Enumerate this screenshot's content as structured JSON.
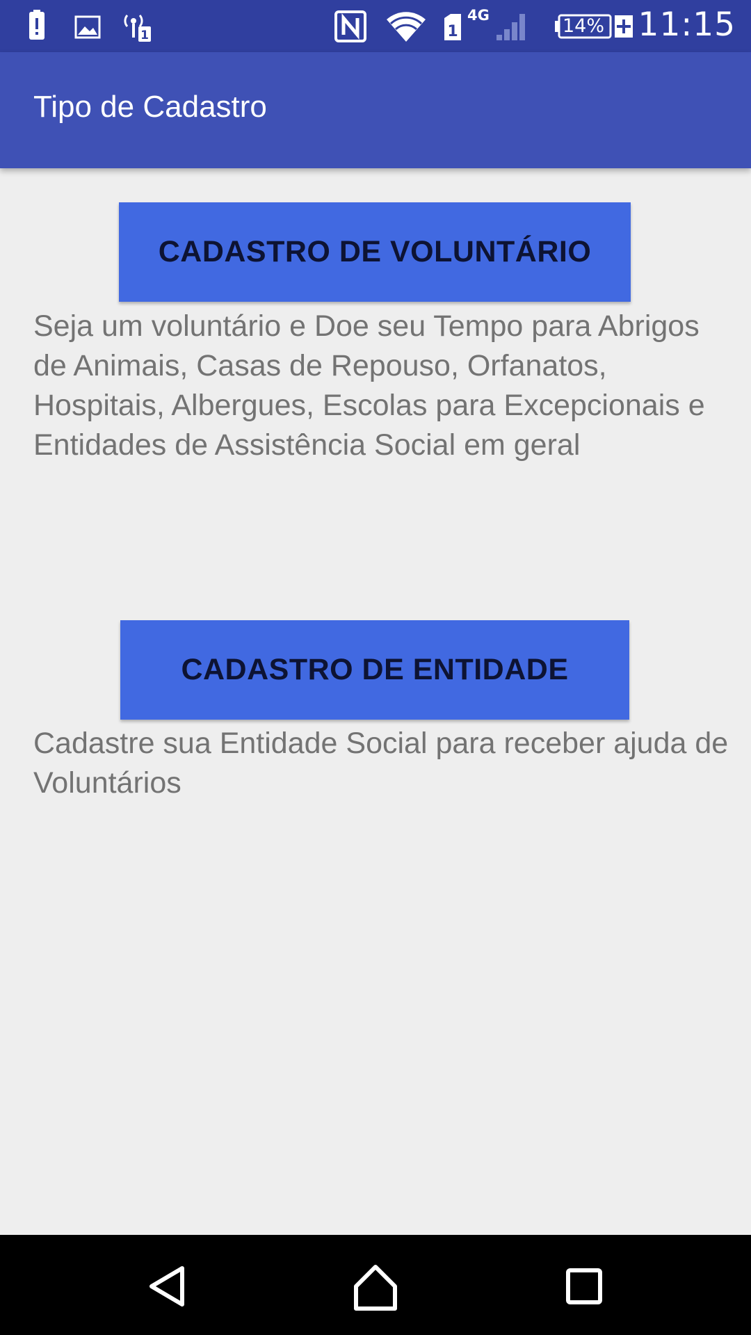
{
  "status_bar": {
    "time": "11:15",
    "battery_percent": "14%",
    "network_type": "4G",
    "sim_slot": "1",
    "icons": [
      "alert-icon",
      "image-icon",
      "hotspot-icon",
      "nfc-icon",
      "wifi-icon",
      "sim-icon",
      "signal-icon",
      "battery-icon",
      "charging-icon"
    ]
  },
  "app_bar": {
    "title": "Tipo de Cadastro"
  },
  "sections": [
    {
      "button_label": "CADASTRO DE VOLUNTÁRIO",
      "description": "Seja um voluntário e Doe seu Tempo para Abrigos de Animais, Casas de Repouso, Orfanatos, Hospitais, Albergues, Escolas para Excepcionais e Entidades de Assistência Social em geral"
    },
    {
      "button_label": "CADASTRO DE ENTIDADE",
      "description": "Cadastre sua Entidade Social para receber ajuda de Voluntários"
    }
  ],
  "nav_bar": {
    "icons": [
      "back-icon",
      "home-icon",
      "recents-icon"
    ]
  },
  "colors": {
    "status_bar": "#303f9f",
    "app_bar": "#3f51b5",
    "button": "#4169e1",
    "button_text": "#0d1333",
    "background": "#eeeeee",
    "description_text": "#737373"
  }
}
